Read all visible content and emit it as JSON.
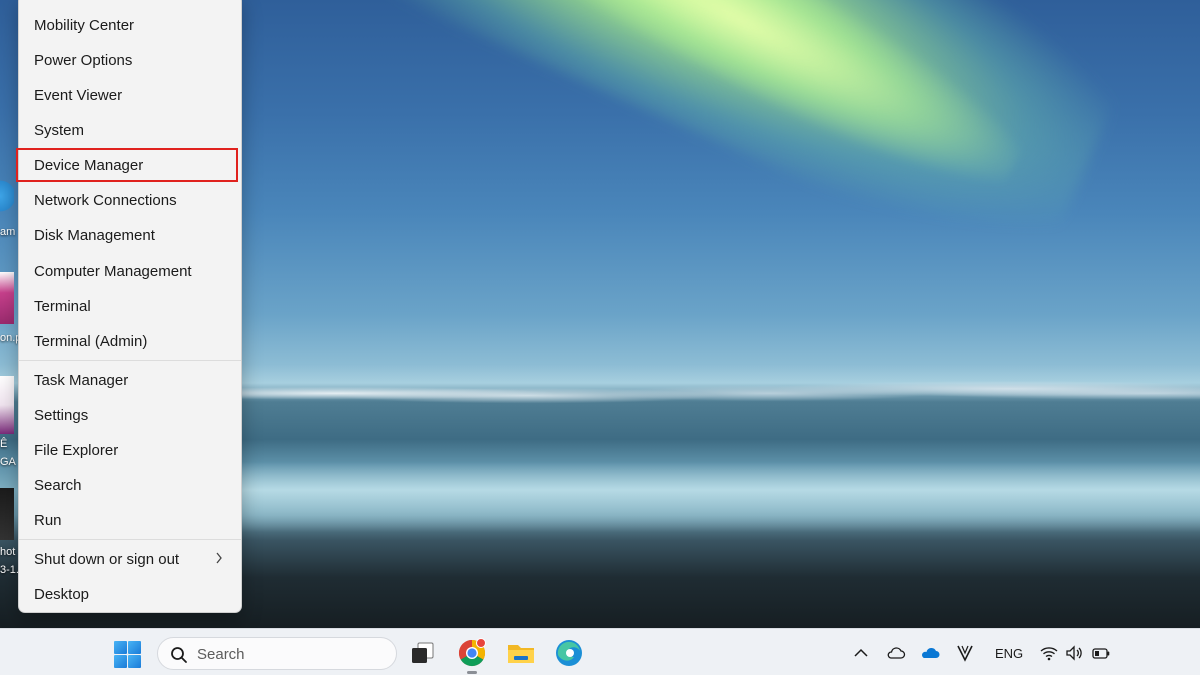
{
  "desktop": {
    "icon_labels": [
      {
        "text": "am"
      },
      {
        "text": "on.p"
      },
      {
        "text": "Ê"
      },
      {
        "text": "GA"
      },
      {
        "text": "hot"
      },
      {
        "text": "3-1."
      }
    ]
  },
  "winx_menu": {
    "items": [
      {
        "label": "Mobility Center"
      },
      {
        "label": "Power Options"
      },
      {
        "label": "Event Viewer"
      },
      {
        "label": "System"
      },
      {
        "label": "Device Manager",
        "highlighted": true
      },
      {
        "label": "Network Connections"
      },
      {
        "label": "Disk Management"
      },
      {
        "label": "Computer Management"
      },
      {
        "label": "Terminal"
      },
      {
        "label": "Terminal (Admin)"
      },
      {
        "label": "Task Manager"
      },
      {
        "label": "Settings"
      },
      {
        "label": "File Explorer"
      },
      {
        "label": "Search"
      },
      {
        "label": "Run"
      },
      {
        "label": "Shut down or sign out",
        "submenu_icon": "chevron-right-icon"
      },
      {
        "label": "Desktop"
      }
    ],
    "highlight_color": "#e0221e"
  },
  "taskbar": {
    "start_icon": "windows-logo-icon",
    "search": {
      "label": "Search",
      "icon": "search-icon"
    },
    "apps": [
      {
        "icon": "task-view-icon"
      },
      {
        "icon": "chrome-icon",
        "running": true
      },
      {
        "icon": "file-explorer-icon"
      },
      {
        "icon": "edge-icon"
      }
    ],
    "tray": {
      "icons": [
        "chevron-up-icon",
        "cloud-outline-icon",
        "onedrive-icon",
        "vpn-v-icon",
        "wifi-icon",
        "volume-icon",
        "battery-icon"
      ],
      "language": "ENG"
    },
    "background": "#eef1f5"
  }
}
